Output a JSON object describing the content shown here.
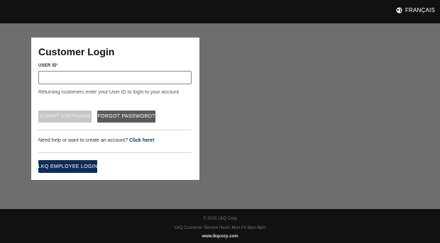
{
  "header": {
    "language_label": "FRANÇAIS"
  },
  "login_card": {
    "title": "Customer Login",
    "user_id_label": "USER ID",
    "required_marker": "*",
    "user_id_value": "",
    "help_text": "Returning customers enter your User ID to login to your account",
    "submit_username_label": "SUBMIT USERNAME",
    "forgot_password_label": "FORGOT PASSWORD?",
    "need_help_text": "Need help or want to create an account?",
    "click_here_label": "Click here!",
    "employee_login_label": "LKQ EMPLOYEE LOGIN"
  },
  "footer": {
    "copyright": "© 2025 LKQ Corp",
    "service_hours": "LKQ Customer Service Hours Mon-Fri 8am-8pm",
    "website": "www.lkqcorp.com"
  },
  "colors": {
    "topbar": "#111111",
    "background": "#6e6e6e",
    "card": "#ffffff",
    "primary_button": "#0d2d58",
    "secondary_button": "#5a5a5a",
    "disabled_button": "#c6c6c6",
    "link": "#0d2f5a"
  },
  "icons": {
    "language": "globe-icon"
  }
}
